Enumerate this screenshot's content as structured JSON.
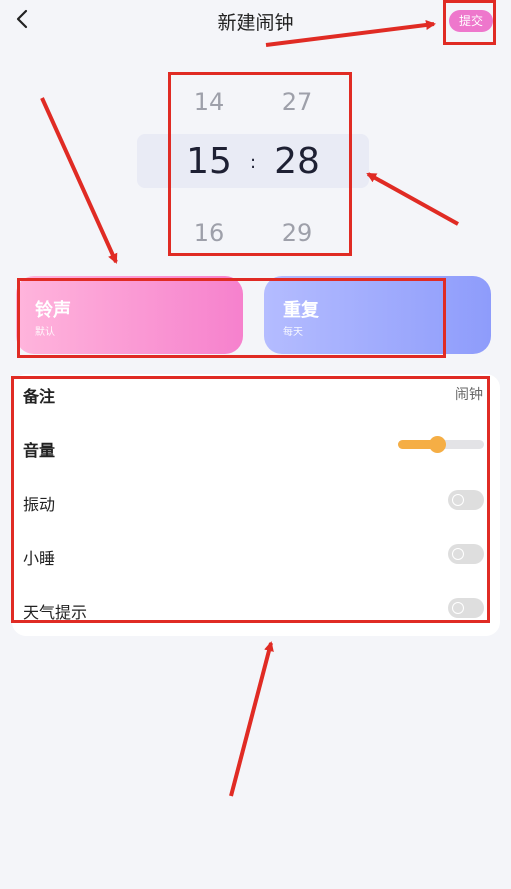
{
  "header": {
    "title": "新建闹钟",
    "submit_label": "提交"
  },
  "picker": {
    "hour_prev": "14",
    "hour": "15",
    "hour_next": "16",
    "minute_prev": "27",
    "minute": "28",
    "minute_next": "29",
    "separator": ":"
  },
  "cards": {
    "ring": {
      "title": "铃声",
      "subtitle": "默认"
    },
    "repeat": {
      "title": "重复",
      "subtitle": "每天"
    }
  },
  "settings": {
    "note": {
      "label": "备注",
      "value": "闹钟"
    },
    "volume": {
      "label": "音量",
      "level": 0.45
    },
    "vibrate": {
      "label": "振动",
      "on": false
    },
    "snooze": {
      "label": "小睡",
      "on": false
    },
    "weather": {
      "label": "天气提示",
      "on": false
    }
  },
  "colors": {
    "annotation_red": "#e02b24",
    "submit_pink": "#ee77cc",
    "volume_orange": "#f5ae45"
  }
}
